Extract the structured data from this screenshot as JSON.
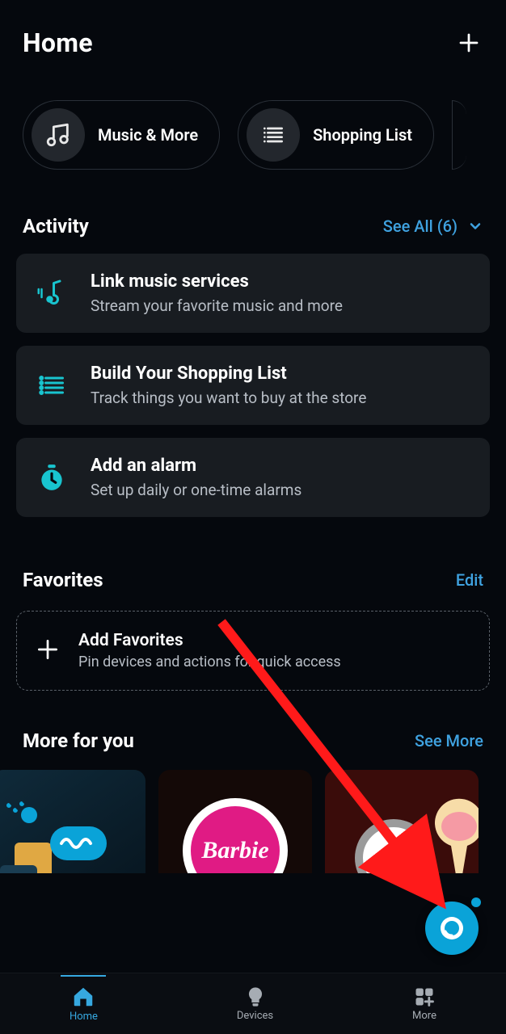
{
  "header": {
    "title": "Home"
  },
  "shortcuts": [
    {
      "label": "Music & More",
      "icon": "music-icon"
    },
    {
      "label": "Shopping List",
      "icon": "list-icon"
    }
  ],
  "activity": {
    "heading": "Activity",
    "see_all_label": "See All (6)",
    "items": [
      {
        "icon": "music-wave-icon",
        "title": "Link music services",
        "subtitle": "Stream your favorite music and more"
      },
      {
        "icon": "list-icon",
        "title": "Build Your Shopping List",
        "subtitle": "Track things you want to buy at the store"
      },
      {
        "icon": "alarm-icon",
        "title": "Add an alarm",
        "subtitle": "Set up daily or one-time alarms"
      }
    ]
  },
  "favorites": {
    "heading": "Favorites",
    "edit_label": "Edit",
    "add_title": "Add Favorites",
    "add_subtitle": "Pin devices and actions for quick access"
  },
  "more": {
    "heading": "More for you",
    "see_more_label": "See More",
    "tiles": [
      {
        "name": "alexa-device-promo"
      },
      {
        "name": "barbie-skill",
        "badge_text": "Barbie"
      },
      {
        "name": "featured-skill"
      }
    ]
  },
  "nav": {
    "items": [
      {
        "label": "Home",
        "icon": "home-icon",
        "active": true
      },
      {
        "label": "Devices",
        "icon": "bulb-icon",
        "active": false
      },
      {
        "label": "More",
        "icon": "grid-plus-icon",
        "active": false
      }
    ]
  },
  "colors": {
    "accent": "#36a8e0",
    "teal": "#18c4cf"
  }
}
